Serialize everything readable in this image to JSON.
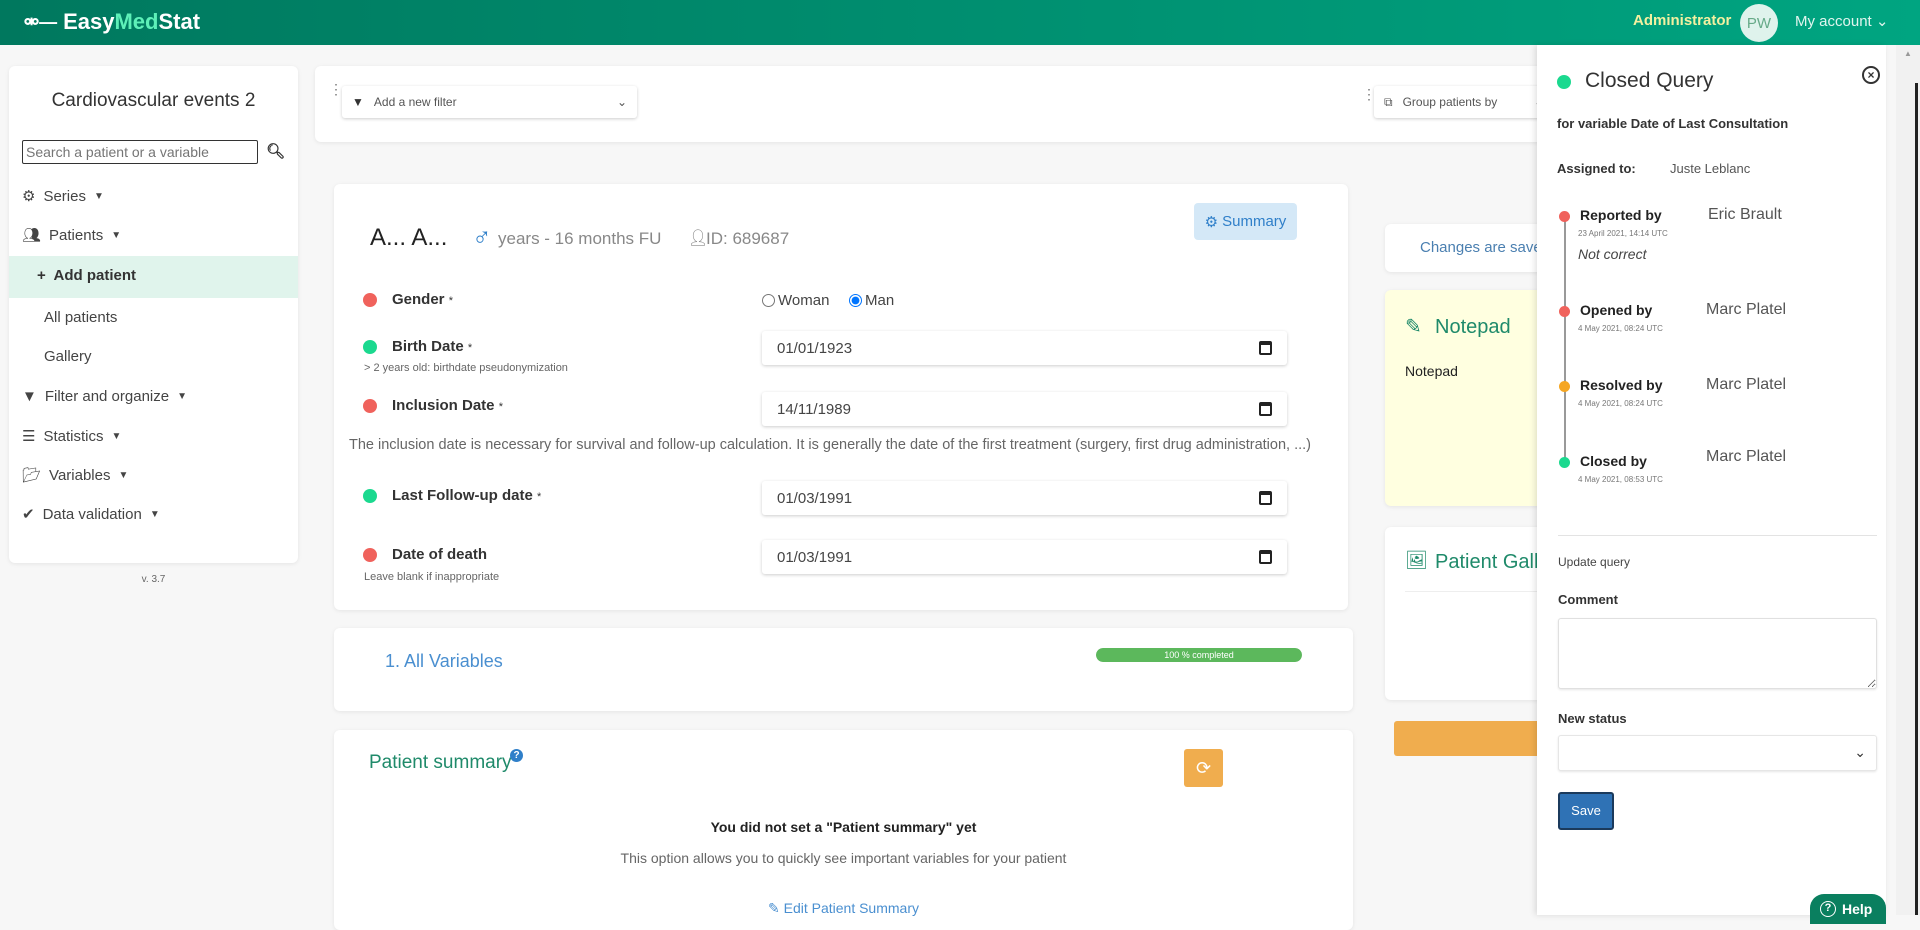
{
  "header": {
    "logo_easy": "Easy",
    "logo_med": "Med",
    "logo_stat": "Stat",
    "role": "Administrator",
    "avatar": "PW",
    "account": "My account"
  },
  "sidebar": {
    "project": "Cardiovascular events 2",
    "search_placeholder": "Search a patient or a variable",
    "items": [
      {
        "label": "Series",
        "icon": "gear-icon"
      },
      {
        "label": "Patients",
        "icon": "users-icon"
      },
      {
        "label": "Filter and organize",
        "icon": "filter-icon"
      },
      {
        "label": "Statistics",
        "icon": "list-icon"
      },
      {
        "label": "Variables",
        "icon": "folder-icon"
      },
      {
        "label": "Data validation",
        "icon": "check-icon"
      }
    ],
    "patients_sub": {
      "add": "Add patient",
      "all": "All patients",
      "gallery": "Gallery"
    },
    "version": "v. 3.7"
  },
  "toolbar": {
    "filter": "Add a new filter",
    "group": "Group patients by"
  },
  "patient": {
    "name": "A... A...",
    "age": "years - 16 months FU",
    "id": "ID: 689687",
    "summary_btn": "Summary",
    "fields": [
      {
        "label": "Gender",
        "req": "*",
        "status": "#f0625c"
      },
      {
        "label": "Birth Date",
        "req": "*",
        "status": "#1bd98f",
        "value": "01/01/1923",
        "hint": "> 2 years old: birthdate pseudonymization"
      },
      {
        "label": "Inclusion Date",
        "req": "*",
        "status": "#f0625c",
        "value": "14/11/1989"
      },
      {
        "label": "Last Follow-up date",
        "req": "*",
        "status": "#1bd98f",
        "value": "01/03/1991"
      },
      {
        "label": "Date of death",
        "req": "",
        "status": "#f0625c",
        "value": "01/03/1991",
        "hint": "Leave blank if inappropriate"
      }
    ],
    "gender_options": [
      "Woman",
      "Man"
    ],
    "gender_selected": "Man",
    "inclusion_note": "The inclusion date is necessary for survival and follow-up calculation. It is generally the date of the first treatment (surgery, first drug administration, ...)"
  },
  "variables": {
    "title": "1. All Variables",
    "progress": 100,
    "progress_label": "100 % completed"
  },
  "summary": {
    "title": "Patient summary",
    "empty": "You did not set a \"Patient summary\" yet",
    "desc": "This option allows you to quickly see important variables for your patient",
    "edit": "Edit Patient Summary"
  },
  "right": {
    "saved": "Changes are save",
    "notepad_title": "Notepad",
    "notepad_text": "Notepad",
    "gallery_title": "Patient Galle"
  },
  "query": {
    "status": "Closed Query",
    "status_color": "#1bd98f",
    "variable": "for variable Date of Last Consultation",
    "assigned_label": "Assigned to:",
    "assigned": "Juste Leblanc",
    "events": [
      {
        "label": "Reported by",
        "date": "23 April 2021, 14:14 UTC",
        "name": "Eric Brault",
        "comment": "Not correct",
        "color": "#f0625c"
      },
      {
        "label": "Opened by",
        "date": "4 May 2021, 08:24 UTC",
        "name": "Marc Platel",
        "color": "#f0625c"
      },
      {
        "label": "Resolved by",
        "date": "4 May 2021, 08:24 UTC",
        "name": "Marc Platel",
        "color": "#f5a623"
      },
      {
        "label": "Closed by",
        "date": "4 May 2021, 08:53 UTC",
        "name": "Marc Platel",
        "color": "#1bd98f"
      }
    ],
    "update": "Update query",
    "comment_label": "Comment",
    "comment_value": "",
    "status_label": "New status",
    "status_value": "",
    "save": "Save"
  },
  "help": "Help"
}
